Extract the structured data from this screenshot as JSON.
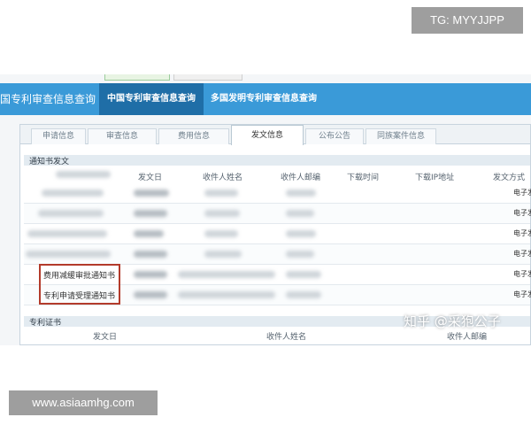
{
  "watermarks": {
    "tg": "TG: MYYJJPP",
    "url": "www.asiaamhg.com",
    "zhihu": "知乎 @采狍公子"
  },
  "header": {
    "site_title": "国专利审查信息查询",
    "nav": [
      {
        "label": "中国专利审查信息查询",
        "active": true
      },
      {
        "label": "多国发明专利审查信息查询",
        "active": false
      }
    ]
  },
  "tabs": [
    {
      "label": "申请信息",
      "active": false
    },
    {
      "label": "审查信息",
      "active": false
    },
    {
      "label": "费用信息",
      "active": false
    },
    {
      "label": "发文信息",
      "active": true
    },
    {
      "label": "公布公告",
      "active": false
    },
    {
      "label": "同族案件信息",
      "active": false
    }
  ],
  "notice_section": {
    "title": "通知书发文",
    "columns": [
      "发文日",
      "收件人姓名",
      "收件人邮编",
      "下载时间",
      "下载IP地址",
      "发文方式"
    ],
    "rows": [
      {
        "name": "",
        "method": "电子发文"
      },
      {
        "name": "",
        "method": "电子发文"
      },
      {
        "name": "",
        "method": "电子发文"
      },
      {
        "name": "",
        "method": "电子发文"
      },
      {
        "name": "费用减缓审批通知书",
        "method": "电子发文"
      },
      {
        "name": "专利申请受理通知书",
        "method": "电子发文"
      }
    ]
  },
  "certificate_section": {
    "title": "专利证书",
    "columns": [
      "发文日",
      "收件人姓名",
      "收件人邮编"
    ]
  },
  "colors": {
    "header_blue": "#3a9ad8",
    "nav_active": "#1f6ea7",
    "highlight_red": "#b33b2b"
  }
}
